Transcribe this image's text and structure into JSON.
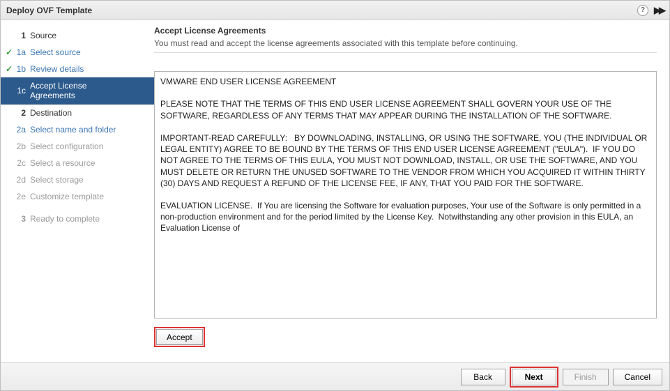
{
  "titlebar": {
    "title": "Deploy OVF Template"
  },
  "sidebar": {
    "steps": [
      {
        "num": "1",
        "label": "Source",
        "type": "top"
      },
      {
        "num": "1a",
        "label": "Select source",
        "done": true,
        "type": "sub"
      },
      {
        "num": "1b",
        "label": "Review details",
        "done": true,
        "type": "sub"
      },
      {
        "num": "1c",
        "label": "Accept License Agreements",
        "active": true,
        "type": "sub"
      },
      {
        "num": "2",
        "label": "Destination",
        "type": "top"
      },
      {
        "num": "2a",
        "label": "Select name and folder",
        "type": "sub"
      },
      {
        "num": "2b",
        "label": "Select configuration",
        "disabled": true,
        "type": "sub"
      },
      {
        "num": "2c",
        "label": "Select a resource",
        "disabled": true,
        "type": "sub"
      },
      {
        "num": "2d",
        "label": "Select storage",
        "disabled": true,
        "type": "sub"
      },
      {
        "num": "2e",
        "label": "Customize template",
        "disabled": true,
        "type": "sub"
      },
      {
        "num": "3",
        "label": "Ready to complete",
        "disabled": true,
        "type": "top"
      }
    ]
  },
  "page": {
    "heading": "Accept License Agreements",
    "sub": "You must read and accept the license agreements associated with this template before continuing."
  },
  "eula_text": "VMWARE END USER LICENSE AGREEMENT\n\nPLEASE NOTE THAT THE TERMS OF THIS END USER LICENSE AGREEMENT SHALL GOVERN YOUR USE OF THE SOFTWARE, REGARDLESS OF ANY TERMS THAT MAY APPEAR DURING THE INSTALLATION OF THE SOFTWARE.\n\nIMPORTANT-READ CAREFULLY:   BY DOWNLOADING, INSTALLING, OR USING THE SOFTWARE, YOU (THE INDIVIDUAL OR LEGAL ENTITY) AGREE TO BE BOUND BY THE TERMS OF THIS END USER LICENSE AGREEMENT (\"EULA\").  IF YOU DO NOT AGREE TO THE TERMS OF THIS EULA, YOU MUST NOT DOWNLOAD, INSTALL, OR USE THE SOFTWARE, AND YOU MUST DELETE OR RETURN THE UNUSED SOFTWARE TO THE VENDOR FROM WHICH YOU ACQUIRED IT WITHIN THIRTY (30) DAYS AND REQUEST A REFUND OF THE LICENSE FEE, IF ANY, THAT YOU PAID FOR THE SOFTWARE.\n\nEVALUATION LICENSE.  If You are licensing the Software for evaluation purposes, Your use of the Software is only permitted in a non-production environment and for the period limited by the License Key.  Notwithstanding any other provision in this EULA, an Evaluation License of",
  "buttons": {
    "accept": "Accept",
    "back": "Back",
    "next": "Next",
    "finish": "Finish",
    "cancel": "Cancel"
  }
}
